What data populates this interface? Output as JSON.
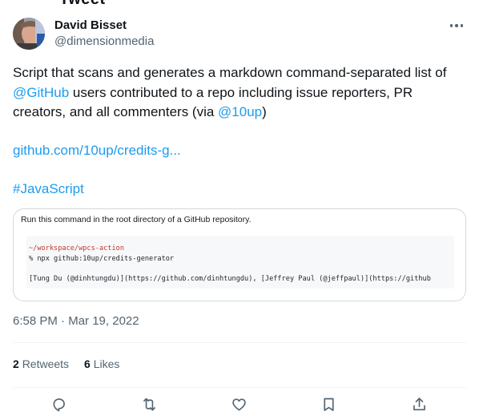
{
  "header_partial": "Tweet",
  "author": {
    "display_name": "David Bisset",
    "handle": "@dimensionmedia"
  },
  "tweet": {
    "text_1": "Script that scans and generates a markdown command-separated list of ",
    "mention_github": "@GitHub",
    "text_2": " users contributed to a repo including issue reporters, PR creators, and all commenters (via ",
    "mention_10up": "@10up",
    "text_3": ")",
    "link": "github.com/10up/credits-g...",
    "hashtag": "#JavaScript"
  },
  "card": {
    "caption": "Run this command in the root directory of a GitHub repository.",
    "terminal": {
      "line_path": "~/workspace/wpcs-action",
      "line_cmd": "% npx github:10up/credits-generator",
      "line_output": "[Tung Du (@dinhtungdu)](https://github.com/dinhtungdu), [Jeffrey Paul (@jeffpaul)](https://github"
    }
  },
  "meta": {
    "time": "6:58 PM",
    "separator": " · ",
    "date": "Mar 19, 2022"
  },
  "stats": {
    "retweets_count": "2",
    "retweets_label": "Retweets",
    "likes_count": "6",
    "likes_label": "Likes"
  },
  "icons": {
    "reply": "reply-icon",
    "retweet": "retweet-icon",
    "like": "heart-icon",
    "bookmark": "bookmark-icon",
    "share": "share-icon"
  },
  "colors": {
    "link": "#1d9bf0",
    "text": "#0f1419",
    "secondary": "#536471"
  }
}
